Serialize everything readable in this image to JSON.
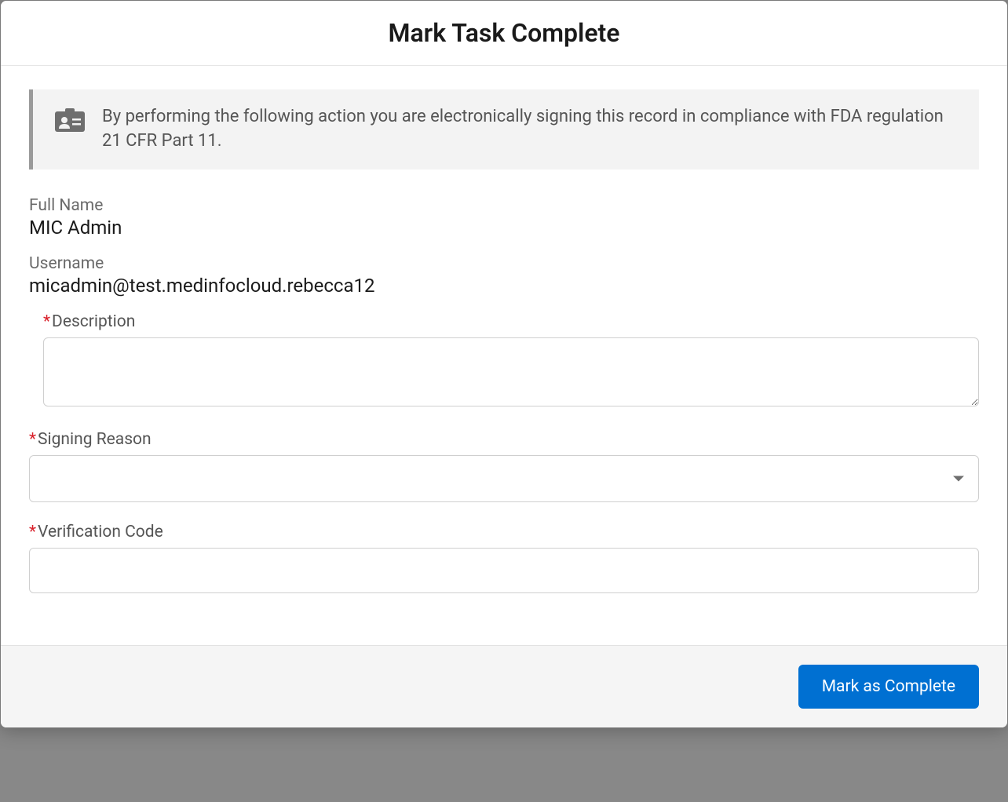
{
  "modal": {
    "title": "Mark Task Complete",
    "banner": {
      "text": "By performing the following action you are electronically signing this record in compliance with FDA regulation 21 CFR Part 11."
    },
    "fields": {
      "full_name_label": "Full Name",
      "full_name_value": "MIC Admin",
      "username_label": "Username",
      "username_value": "micadmin@test.medinfocloud.rebecca12"
    },
    "form": {
      "description_label": "Description",
      "description_value": "",
      "signing_reason_label": "Signing Reason",
      "signing_reason_value": "",
      "verification_code_label": "Verification Code",
      "verification_code_value": ""
    },
    "footer": {
      "submit_label": "Mark as Complete"
    }
  }
}
